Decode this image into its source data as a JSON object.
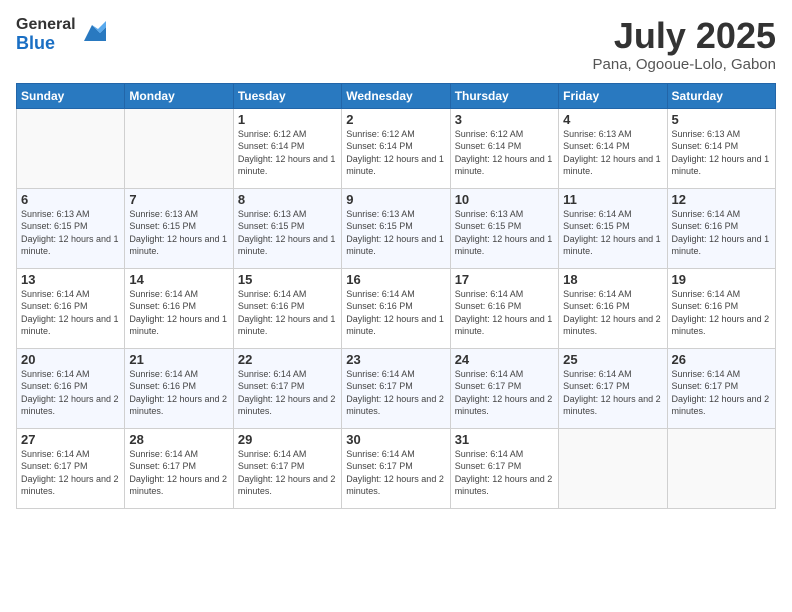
{
  "logo": {
    "general": "General",
    "blue": "Blue"
  },
  "title": "July 2025",
  "location": "Pana, Ogooue-Lolo, Gabon",
  "days_header": [
    "Sunday",
    "Monday",
    "Tuesday",
    "Wednesday",
    "Thursday",
    "Friday",
    "Saturday"
  ],
  "weeks": [
    [
      {
        "day": "",
        "info": ""
      },
      {
        "day": "",
        "info": ""
      },
      {
        "day": "1",
        "info": "Sunrise: 6:12 AM\nSunset: 6:14 PM\nDaylight: 12 hours\nand 1 minute."
      },
      {
        "day": "2",
        "info": "Sunrise: 6:12 AM\nSunset: 6:14 PM\nDaylight: 12 hours\nand 1 minute."
      },
      {
        "day": "3",
        "info": "Sunrise: 6:12 AM\nSunset: 6:14 PM\nDaylight: 12 hours\nand 1 minute."
      },
      {
        "day": "4",
        "info": "Sunrise: 6:13 AM\nSunset: 6:14 PM\nDaylight: 12 hours\nand 1 minute."
      },
      {
        "day": "5",
        "info": "Sunrise: 6:13 AM\nSunset: 6:14 PM\nDaylight: 12 hours\nand 1 minute."
      }
    ],
    [
      {
        "day": "6",
        "info": "Sunrise: 6:13 AM\nSunset: 6:15 PM\nDaylight: 12 hours\nand 1 minute."
      },
      {
        "day": "7",
        "info": "Sunrise: 6:13 AM\nSunset: 6:15 PM\nDaylight: 12 hours\nand 1 minute."
      },
      {
        "day": "8",
        "info": "Sunrise: 6:13 AM\nSunset: 6:15 PM\nDaylight: 12 hours\nand 1 minute."
      },
      {
        "day": "9",
        "info": "Sunrise: 6:13 AM\nSunset: 6:15 PM\nDaylight: 12 hours\nand 1 minute."
      },
      {
        "day": "10",
        "info": "Sunrise: 6:13 AM\nSunset: 6:15 PM\nDaylight: 12 hours\nand 1 minute."
      },
      {
        "day": "11",
        "info": "Sunrise: 6:14 AM\nSunset: 6:15 PM\nDaylight: 12 hours\nand 1 minute."
      },
      {
        "day": "12",
        "info": "Sunrise: 6:14 AM\nSunset: 6:16 PM\nDaylight: 12 hours\nand 1 minute."
      }
    ],
    [
      {
        "day": "13",
        "info": "Sunrise: 6:14 AM\nSunset: 6:16 PM\nDaylight: 12 hours\nand 1 minute."
      },
      {
        "day": "14",
        "info": "Sunrise: 6:14 AM\nSunset: 6:16 PM\nDaylight: 12 hours\nand 1 minute."
      },
      {
        "day": "15",
        "info": "Sunrise: 6:14 AM\nSunset: 6:16 PM\nDaylight: 12 hours\nand 1 minute."
      },
      {
        "day": "16",
        "info": "Sunrise: 6:14 AM\nSunset: 6:16 PM\nDaylight: 12 hours\nand 1 minute."
      },
      {
        "day": "17",
        "info": "Sunrise: 6:14 AM\nSunset: 6:16 PM\nDaylight: 12 hours\nand 1 minute."
      },
      {
        "day": "18",
        "info": "Sunrise: 6:14 AM\nSunset: 6:16 PM\nDaylight: 12 hours\nand 2 minutes."
      },
      {
        "day": "19",
        "info": "Sunrise: 6:14 AM\nSunset: 6:16 PM\nDaylight: 12 hours\nand 2 minutes."
      }
    ],
    [
      {
        "day": "20",
        "info": "Sunrise: 6:14 AM\nSunset: 6:16 PM\nDaylight: 12 hours\nand 2 minutes."
      },
      {
        "day": "21",
        "info": "Sunrise: 6:14 AM\nSunset: 6:16 PM\nDaylight: 12 hours\nand 2 minutes."
      },
      {
        "day": "22",
        "info": "Sunrise: 6:14 AM\nSunset: 6:17 PM\nDaylight: 12 hours\nand 2 minutes."
      },
      {
        "day": "23",
        "info": "Sunrise: 6:14 AM\nSunset: 6:17 PM\nDaylight: 12 hours\nand 2 minutes."
      },
      {
        "day": "24",
        "info": "Sunrise: 6:14 AM\nSunset: 6:17 PM\nDaylight: 12 hours\nand 2 minutes."
      },
      {
        "day": "25",
        "info": "Sunrise: 6:14 AM\nSunset: 6:17 PM\nDaylight: 12 hours\nand 2 minutes."
      },
      {
        "day": "26",
        "info": "Sunrise: 6:14 AM\nSunset: 6:17 PM\nDaylight: 12 hours\nand 2 minutes."
      }
    ],
    [
      {
        "day": "27",
        "info": "Sunrise: 6:14 AM\nSunset: 6:17 PM\nDaylight: 12 hours\nand 2 minutes."
      },
      {
        "day": "28",
        "info": "Sunrise: 6:14 AM\nSunset: 6:17 PM\nDaylight: 12 hours\nand 2 minutes."
      },
      {
        "day": "29",
        "info": "Sunrise: 6:14 AM\nSunset: 6:17 PM\nDaylight: 12 hours\nand 2 minutes."
      },
      {
        "day": "30",
        "info": "Sunrise: 6:14 AM\nSunset: 6:17 PM\nDaylight: 12 hours\nand 2 minutes."
      },
      {
        "day": "31",
        "info": "Sunrise: 6:14 AM\nSunset: 6:17 PM\nDaylight: 12 hours\nand 2 minutes."
      },
      {
        "day": "",
        "info": ""
      },
      {
        "day": "",
        "info": ""
      }
    ]
  ]
}
